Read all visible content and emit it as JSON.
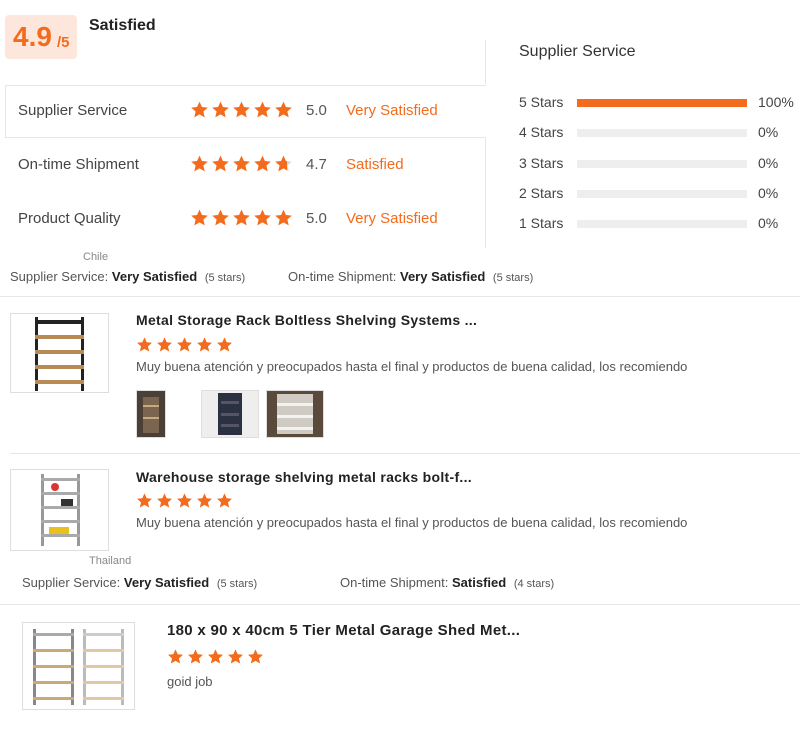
{
  "overall": {
    "score": "4.9",
    "outof": "/5",
    "label": "Satisfied"
  },
  "ratings": [
    {
      "label": "Supplier Service",
      "value": "5.0",
      "text": "Very Satisfied",
      "stars": 5
    },
    {
      "label": "On-time Shipment",
      "value": "4.7",
      "text": "Satisfied",
      "stars": 4.7
    },
    {
      "label": "Product Quality",
      "value": "5.0",
      "text": "Very Satisfied",
      "stars": 5
    }
  ],
  "distribution": {
    "title": "Supplier Service",
    "rows": [
      {
        "label": "5  Stars",
        "pct": "100%",
        "fraction": 1.0
      },
      {
        "label": "4  Stars",
        "pct": "0%",
        "fraction": 0
      },
      {
        "label": "3  Stars",
        "pct": "0%",
        "fraction": 0
      },
      {
        "label": "2  Stars",
        "pct": "0%",
        "fraction": 0
      },
      {
        "label": "1  Stars",
        "pct": "0%",
        "fraction": 0
      }
    ]
  },
  "reviewers": [
    {
      "country": "Chile",
      "service_label": "Supplier Service:",
      "service_value": "Very Satisfied",
      "service_count": "(5 stars)",
      "shipment_label": "On-time Shipment:",
      "shipment_value": "Very Satisfied",
      "shipment_count": "(5 stars)"
    },
    {
      "country": "Thailand",
      "service_label": "Supplier Service:",
      "service_value": "Very Satisfied",
      "service_count": "(5 stars)",
      "shipment_label": "On-time Shipment:",
      "shipment_value": "Satisfied",
      "shipment_count": "(4 stars)"
    }
  ],
  "reviews": [
    {
      "title": "Metal Storage Rack Boltless Shelving Systems ...",
      "stars": 5,
      "text": "Muy buena atención y preocupados hasta el final y productos de buena calidad, los recomiendo"
    },
    {
      "title": "Warehouse storage shelving metal racks bolt-f...",
      "stars": 5,
      "text": "Muy buena atención y preocupados hasta el final y productos de buena calidad, los recomiendo"
    },
    {
      "title": "180 x 90 x 40cm 5 Tier Metal Garage Shed Met...",
      "stars": 5,
      "text": "goid job"
    }
  ],
  "colors": {
    "accent": "#f36b1c",
    "star_empty": "#d8d8d8",
    "badge_bg": "#fde7dc"
  }
}
